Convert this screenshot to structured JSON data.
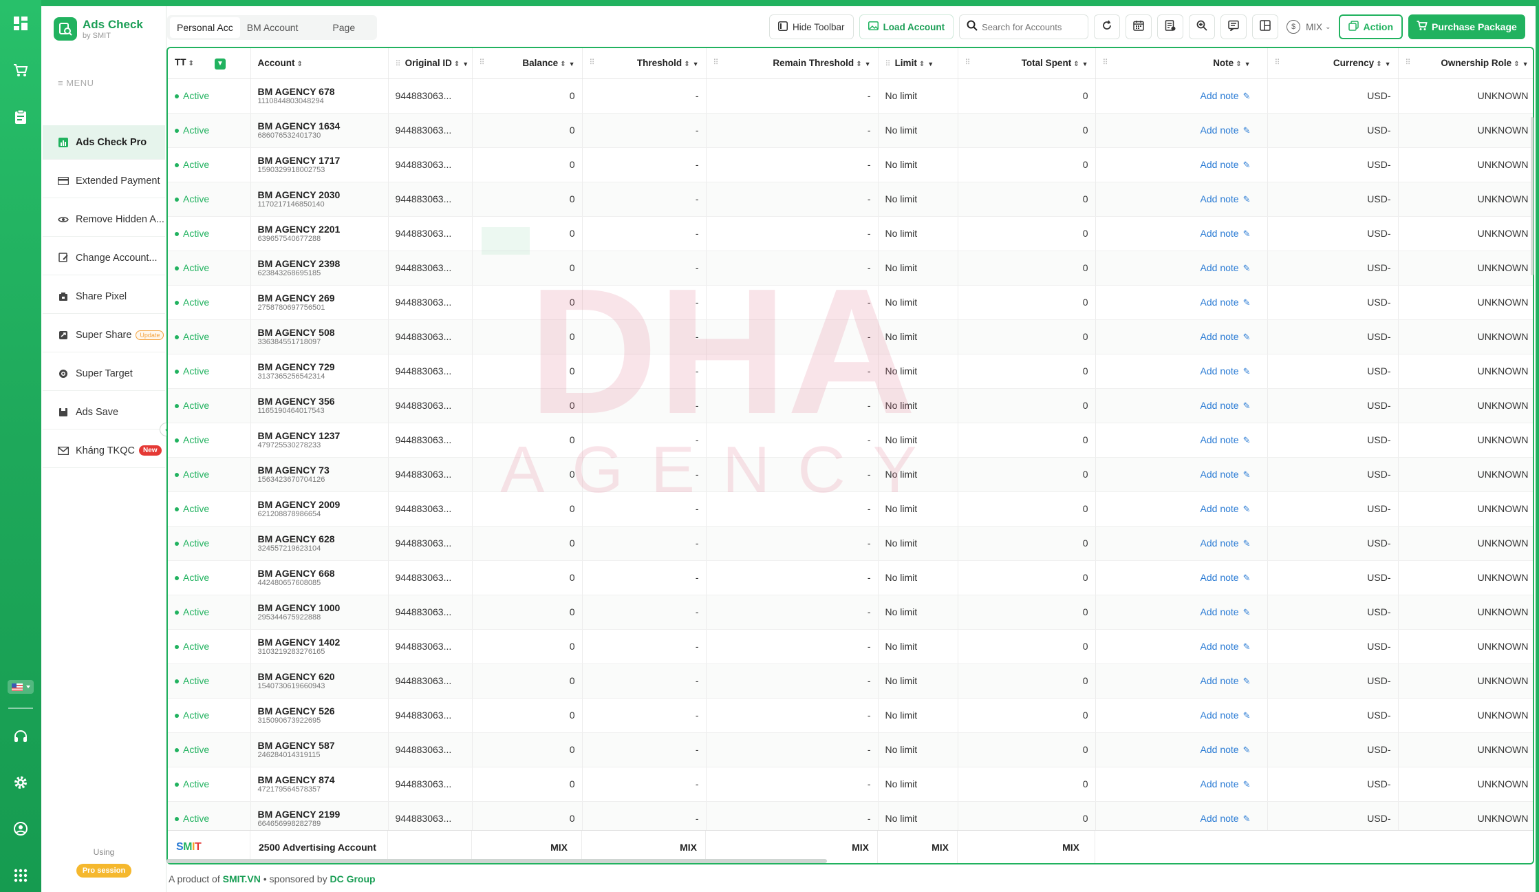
{
  "app": {
    "title": "Ads Check",
    "subtitle": "by SMIT"
  },
  "rail": {
    "icons": [
      "dashboard-icon",
      "cart-icon",
      "clipboard-icon",
      "flag-icon",
      "headset-icon",
      "gear-icon",
      "user-circle-icon",
      "apps-grid-icon"
    ]
  },
  "sidebar": {
    "menu_label": "≡ MENU",
    "items": [
      {
        "label": "Ads Check Pro",
        "icon": "chart-icon",
        "active": true
      },
      {
        "label": "Extended Payment",
        "icon": "card-icon"
      },
      {
        "label": "Remove Hidden A...",
        "icon": "eye-off-icon"
      },
      {
        "label": "Change Account...",
        "icon": "edit-icon"
      },
      {
        "label": "Share Pixel",
        "icon": "pixel-icon"
      },
      {
        "label": "Super Share",
        "icon": "share-icon",
        "badge": "Update"
      },
      {
        "label": "Super Target",
        "icon": "target-icon"
      },
      {
        "label": "Ads Save",
        "icon": "save-icon"
      },
      {
        "label": "Kháng TKQC",
        "icon": "mail-icon",
        "badge": "New"
      }
    ],
    "using_label": "Using",
    "session_label": "Pro session"
  },
  "tabs": [
    "Personal Acc",
    "BM Account",
    "Page"
  ],
  "toolbar": {
    "hide_toolbar": "Hide Toolbar",
    "load_account": "Load Account",
    "search_placeholder": "Search for Accounts",
    "currency": "MIX",
    "action": "Action",
    "purchase": "Purchase Package"
  },
  "table": {
    "columns": [
      "TT",
      "Account",
      "Original ID",
      "Balance",
      "Threshold",
      "Remain Threshold",
      "Limit",
      "Total Spent",
      "Note",
      "Currency",
      "Ownership Role"
    ],
    "status_label": "Active",
    "original_id": "944883063...",
    "balance": "0",
    "threshold": "-",
    "remain": "-",
    "limit": "No limit",
    "spent": "0",
    "note": "Add note",
    "currency": "USD-",
    "role": "UNKNOWN",
    "rows": [
      {
        "name": "BM AGENCY 678",
        "id": "1110844803048294"
      },
      {
        "name": "BM AGENCY 1634",
        "id": "686076532401730"
      },
      {
        "name": "BM AGENCY 1717",
        "id": "1590329918002753"
      },
      {
        "name": "BM AGENCY 2030",
        "id": "1170217146850140"
      },
      {
        "name": "BM AGENCY 2201",
        "id": "639657540677288"
      },
      {
        "name": "BM AGENCY 2398",
        "id": "623843268695185"
      },
      {
        "name": "BM AGENCY 269",
        "id": "2758780697756501"
      },
      {
        "name": "BM AGENCY 508",
        "id": "336384551718097"
      },
      {
        "name": "BM AGENCY 729",
        "id": "3137365256542314"
      },
      {
        "name": "BM AGENCY 356",
        "id": "1165190464017543"
      },
      {
        "name": "BM AGENCY 1237",
        "id": "479725530278233"
      },
      {
        "name": "BM AGENCY 73",
        "id": "1563423670704126"
      },
      {
        "name": "BM AGENCY 2009",
        "id": "621208878986654"
      },
      {
        "name": "BM AGENCY 628",
        "id": "324557219623104"
      },
      {
        "name": "BM AGENCY 668",
        "id": "442480657608085"
      },
      {
        "name": "BM AGENCY 1000",
        "id": "295344675922888"
      },
      {
        "name": "BM AGENCY 1402",
        "id": "3103219283276165"
      },
      {
        "name": "BM AGENCY 620",
        "id": "1540730619660943"
      },
      {
        "name": "BM AGENCY 526",
        "id": "315090673922695"
      },
      {
        "name": "BM AGENCY 587",
        "id": "246284014319115"
      },
      {
        "name": "BM AGENCY 874",
        "id": "472179564578357"
      },
      {
        "name": "BM AGENCY 2199",
        "id": "664656998282789"
      }
    ],
    "footer": {
      "logo": "SMIT",
      "total_label": "2500 Advertising Account",
      "mix": "MIX"
    }
  },
  "credit": {
    "prefix": "A product of",
    "brand": "SMIT.VN",
    "middle": "sponsored by",
    "sponsor": "DC Group"
  },
  "watermark": {
    "top": "DHA",
    "bottom": "AGENCY"
  },
  "colors": {
    "accent": "#21b25f",
    "link": "#2a7bd4",
    "watermark": "#e0607e"
  }
}
